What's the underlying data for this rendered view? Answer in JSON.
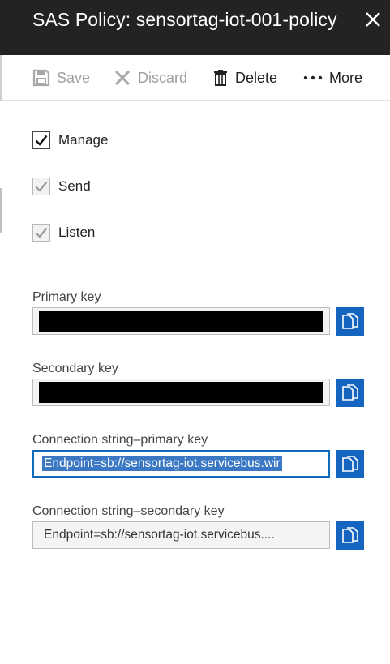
{
  "header": {
    "title": "SAS Policy: sensortag-iot-001-policy"
  },
  "toolbar": {
    "save_label": "Save",
    "discard_label": "Discard",
    "delete_label": "Delete",
    "more_label": "More"
  },
  "permissions": [
    {
      "label": "Manage",
      "checked": true,
      "disabled": false
    },
    {
      "label": "Send",
      "checked": true,
      "disabled": true
    },
    {
      "label": "Listen",
      "checked": true,
      "disabled": true
    }
  ],
  "keys": {
    "primary_label": "Primary key",
    "secondary_label": "Secondary key",
    "conn_primary_label": "Connection string–primary key",
    "conn_primary_value": "Endpoint=sb://sensortag-iot.servicebus.wir",
    "conn_secondary_label": "Connection string–secondary key",
    "conn_secondary_value": "Endpoint=sb://sensortag-iot.servicebus...."
  },
  "colors": {
    "header_bg": "#232323",
    "accent": "#1565c0"
  },
  "icons": [
    "close-icon",
    "save-icon",
    "discard-icon",
    "delete-icon",
    "more-icon",
    "checkmark-icon",
    "copy-icon"
  ]
}
